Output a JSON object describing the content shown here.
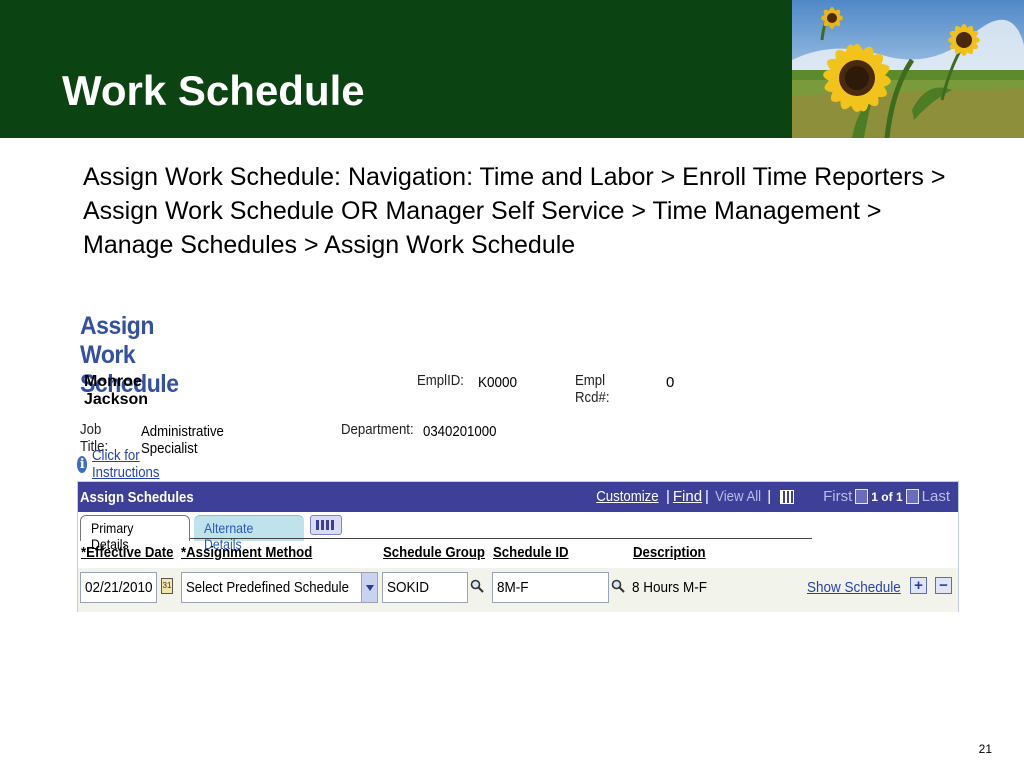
{
  "slide": {
    "title": "Work Schedule",
    "intro": "Assign Work Schedule: Navigation: Time and Labor > Enroll Time Reporters > Assign Work Schedule OR Manager Self Service > Time Management > Manage Schedules > Assign Work Schedule",
    "page_number": "21"
  },
  "page": {
    "title": "Assign Work Schedule",
    "employee_name": "Monroe Jackson",
    "emplid_label": "EmplID:",
    "emplid_value": "K0000",
    "empl_rcd_label": "Empl Rcd#:",
    "empl_rcd_value": "0",
    "job_title_label": "Job Title:",
    "job_title_value": "Administrative Specialist",
    "department_label": "Department:",
    "department_value": "0340201000",
    "instructions_link": "Click for Instructions"
  },
  "grid": {
    "title": "Assign Schedules",
    "customize": "Customize",
    "find": "Find",
    "view_all": "View All",
    "separator": "|",
    "first": "First",
    "range": "1 of 1",
    "last": "Last",
    "tabs": [
      "Primary Details",
      "Alternate Details"
    ],
    "columns": [
      "*Effective Date",
      "*Assignment Method",
      "Schedule Group",
      "Schedule ID",
      "Description"
    ],
    "row": {
      "effective_date": "02/21/2010",
      "assignment_method": "Select Predefined Schedule",
      "schedule_group": "SOKID",
      "schedule_id": "8M-F",
      "description": "8 Hours M-F",
      "show_schedule": "Show Schedule",
      "calendar_day": "31"
    },
    "add_symbol": "+",
    "delete_symbol": "−"
  },
  "colors": {
    "banner": "#0c4312",
    "grid_bar": "#3e3f98",
    "page_title": "#3450a0",
    "link": "#2443b0"
  },
  "icons": [
    "info-icon",
    "calendar-icon",
    "dropdown-arrow-icon",
    "lookup-magnifier-icon",
    "add-row-icon",
    "delete-row-icon",
    "grid-view-icon",
    "previous-icon",
    "next-icon",
    "show-all-tabs-icon"
  ]
}
